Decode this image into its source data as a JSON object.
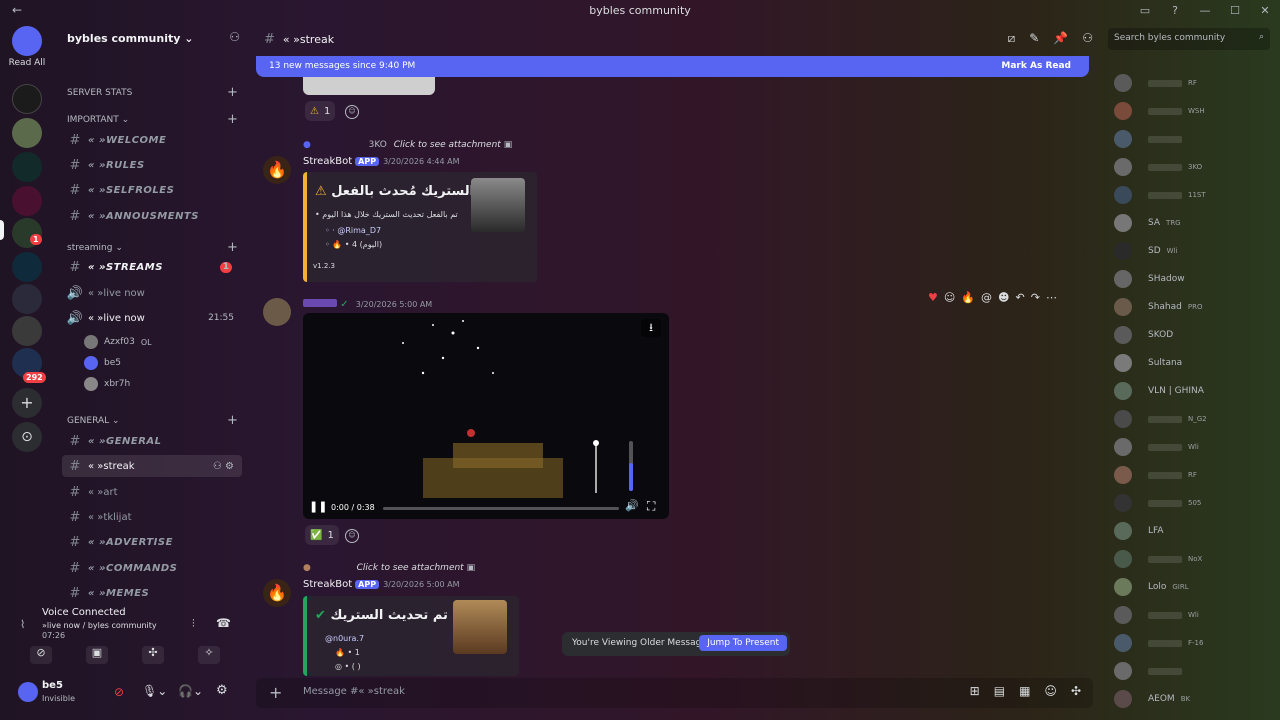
{
  "window": {
    "title": "bybles community",
    "back": "←",
    "buttons": [
      "▭",
      "?",
      "—",
      "☐",
      "✕"
    ]
  },
  "rail": {
    "read_all": "Read All",
    "badge_1": "1",
    "badge_292": "292"
  },
  "guild": {
    "name": "bybles community ⌄"
  },
  "categories": {
    "server_stats": "SERVER STATS",
    "important": "IMPORTANT ⌄",
    "streaming": "streaming ⌄",
    "general": "GENERAL ⌄"
  },
  "channels": {
    "welcome": "«   »WELCOME",
    "rules": "«   »RULES",
    "selfroles": "«   »SELFROLES",
    "annousments": "«   »ANNOUSMENTS",
    "streams": "«   »STREAMS",
    "live_now_1": "«   »live now",
    "live_now_2": "«   »live now",
    "general": "«   »GENERAL",
    "streak": "«   »streak",
    "art": "«   »art",
    "tklijat": "«   »tklijat",
    "advertise": "«   »ADVERTISE",
    "commands": "«   »COMMANDS",
    "memes": "«   »MEMES",
    "streams_badge": "1",
    "live_time": "21:55"
  },
  "voice_users": [
    {
      "name": "Azxf03",
      "tag": "OL"
    },
    {
      "name": "be5",
      "tag": ""
    },
    {
      "name": "xbr7h",
      "tag": ""
    }
  ],
  "voice_panel": {
    "status": "Voice Connected",
    "location": "»live now / byles community",
    "timer": "07:26"
  },
  "user_panel": {
    "name": "be5",
    "status": "Invisible"
  },
  "header": {
    "channel": "«   »streak",
    "search_placeholder": "Search byles community"
  },
  "new_messages": {
    "text": "13 new messages since 9:40 PM",
    "mark": "Mark As Read"
  },
  "messages": {
    "reaction_top_count": "1",
    "streakbot1": {
      "reply_tag": "3KO",
      "reply_link": "Click to see attachment",
      "name": "StreakBot",
      "app": "APP",
      "time": "3/20/2026 4:44 AM",
      "title": "الستريك مُحدث بالفعل •",
      "line1": "تم بالفعل تحديث الستريك خلال هذا اليوم",
      "line2": "@Rima_D7",
      "line3": "4 (اليوم)",
      "footer": "v1.2.3"
    },
    "video_msg": {
      "time": "3/20/2026 5:00 AM",
      "timecode": "0:00 / 0:38",
      "reaction_count": "1"
    },
    "streakbot2": {
      "reply_link": "Click to see attachment",
      "name": "StreakBot",
      "app": "APP",
      "time": "3/20/2026 5:00 AM",
      "title": "تم تحديث الستريك •",
      "line1": "@n0ura.7",
      "line2": "1",
      "line3": "( )"
    }
  },
  "older": {
    "text": "You're Viewing Older Messages",
    "jump": "Jump To Present"
  },
  "composer": {
    "placeholder": "Message #«   »streak"
  },
  "members": [
    {
      "name": "",
      "tag": "RF"
    },
    {
      "name": "",
      "tag": "WSH"
    },
    {
      "name": "",
      "tag": ""
    },
    {
      "name": "",
      "tag": "3KO"
    },
    {
      "name": "",
      "tag": "11ST"
    },
    {
      "name": "SA",
      "tag": "TRG"
    },
    {
      "name": "SD",
      "tag": "Wli"
    },
    {
      "name": "SHadow",
      "tag": ""
    },
    {
      "name": "Shahad",
      "tag": "PRO"
    },
    {
      "name": "SKOD",
      "tag": ""
    },
    {
      "name": "Sultana",
      "tag": ""
    },
    {
      "name": "VLN | GHINA",
      "tag": ""
    },
    {
      "name": "",
      "tag": "N_G2"
    },
    {
      "name": "",
      "tag": "Wli"
    },
    {
      "name": "",
      "tag": "RF"
    },
    {
      "name": "",
      "tag": "505"
    },
    {
      "name": "LFA",
      "tag": ""
    },
    {
      "name": "",
      "tag": "NoX"
    },
    {
      "name": "Lolo",
      "tag": "GIRL"
    },
    {
      "name": "",
      "tag": "Wli"
    },
    {
      "name": "",
      "tag": "F-16"
    },
    {
      "name": "",
      "tag": ""
    },
    {
      "name": "AEOM",
      "tag": "BK"
    }
  ],
  "colors": {
    "blurple": "#5865f2",
    "red": "#f23f43",
    "green": "#23a55a"
  }
}
